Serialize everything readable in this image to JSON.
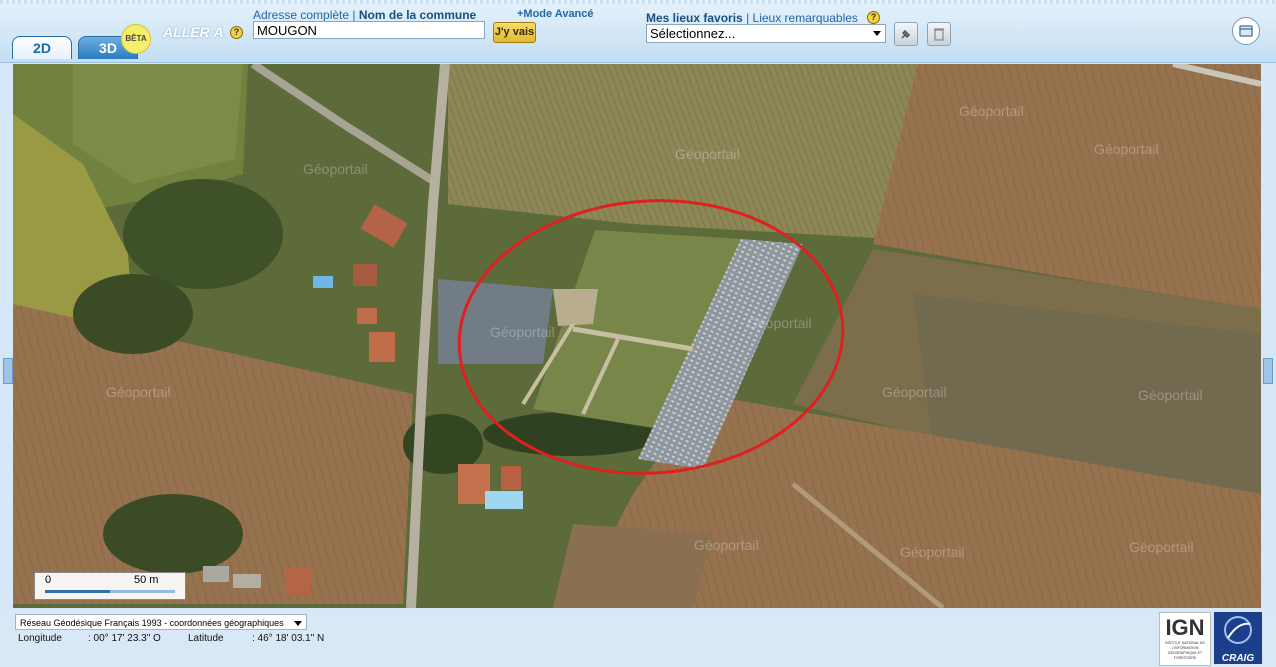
{
  "tabs": [
    {
      "label": "2D"
    },
    {
      "label": "3D"
    }
  ],
  "beta_badge": "BÊTA",
  "goto": {
    "title": "ALLER À",
    "help": "?",
    "mode_full": "Adresse complète",
    "separator": "|",
    "mode_commune": "Nom de la commune",
    "advanced": "+Mode Avancé",
    "input_value": "MOUGON",
    "submit": "J'y vais"
  },
  "favorites": {
    "label": "Mes lieux favoris",
    "separator": "|",
    "remarkable": "Lieux remarquables",
    "help": "?",
    "select_value": "Sélectionnez..."
  },
  "map": {
    "watermark": "Géoportail",
    "scale_start": "0",
    "scale_end": "50 m",
    "annotation_color": "#e02020"
  },
  "footer": {
    "projection": "Réseau Géodésique Français 1993 - coordonnées géographiques",
    "longitude_label": "Longitude",
    "longitude_value": ": 00° 17' 23.3\" O",
    "latitude_label": "Latitude",
    "latitude_value": ": 46° 18' 03.1\" N",
    "logo_ign": "IGN",
    "logo_ign_sub": "INSTITUT NATIONAL DE L'INFORMATION GÉOGRAPHIQUE ET FORESTIÈRE",
    "logo_craig": "CRAIG"
  }
}
